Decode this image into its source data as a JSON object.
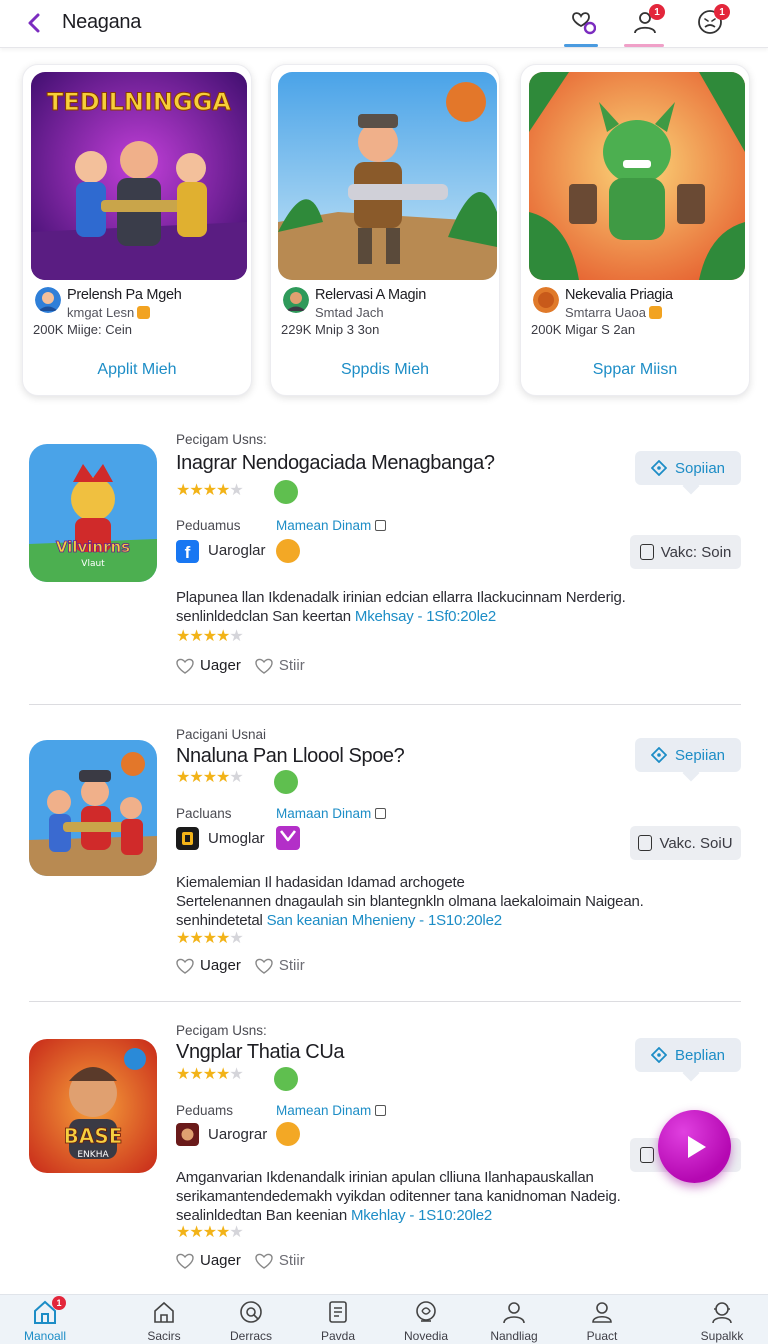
{
  "header": {
    "title": "Neagana",
    "badge_1": "1",
    "badge_2": "1",
    "colors": {
      "accent": "#7b2cbf",
      "badge": "#e3263b"
    }
  },
  "cards": [
    {
      "image_text": "TEDILNINGGA",
      "name": "Prelensh Pa Mgeh",
      "sub": "kmgat Lesn",
      "stat": "200K Miige: Cein",
      "button": "Applit Mieh"
    },
    {
      "image_text": "",
      "name": "Relervasi A Magin",
      "sub": "Smtad Jach",
      "stat": "229K Mnip 3 3on",
      "button": "Sppdis Mieh"
    },
    {
      "image_text": "",
      "name": "Nekevalia Priagia",
      "sub": "Smtarra Uaoa",
      "stat": "200K Migar S 2an",
      "button": "Sppar Miisn"
    }
  ],
  "items": [
    {
      "kicker": "Pecigam Usns:",
      "headline": "Inagrar Nendogaciada Menagbanga?",
      "thumb_text": "Vilvinrns",
      "thumb_sub": "Vlaut",
      "label_left": "Peduamus",
      "label_right": "Mamean Dinam",
      "brand_label": "Uaroglar",
      "desc_1": "Plapunea llan Ikdenadalk irinian edcian ellarra Ilackucinnam Nerderig.",
      "desc_2_pre": "senlinldedclan San keertan ",
      "desc_2_link": "Mkehsay - 1Sf0:20le2",
      "desc_3_pre": "",
      "desc_3_link": "",
      "like": "Uager",
      "share": "Stiir",
      "pill": "Sopiian",
      "pill2": "Vakc: Soin",
      "rating": 4,
      "rating2": 4
    },
    {
      "kicker": "Pacigani Usnai",
      "headline": "Nnaluna Pan Lloool Spoe?",
      "thumb_text": "",
      "thumb_sub": "",
      "label_left": "Pacluans",
      "label_right": "Mamaan Dinam",
      "brand_label": "Umoglar",
      "desc_1": "Kiemalemian Il hadasidan Idamad archogete",
      "desc_2_pre": "Sertelenannen dnagaulah sin blantegnkln olmana laekaloimain Naigean.",
      "desc_2_link": "",
      "desc_3_pre": "senhindetetal ",
      "desc_3_link": "San keanian Mhenieny - 1S10:20le2",
      "like": "Uager",
      "share": "Stiir",
      "pill": "Sepiian",
      "pill2": "Vakc. SoiU",
      "rating": 4,
      "rating2": 4
    },
    {
      "kicker": "Pecigam Usns:",
      "headline": "Vngplar Thatia CUa",
      "thumb_text": "BASE",
      "thumb_sub": "ENKHA",
      "label_left": "Peduams",
      "label_right": "Mamean Dinam",
      "brand_label": "Uarograr",
      "desc_1": "Amganvarian Ikdenandalk irinian apulan clliuna Ilanhapauskallan",
      "desc_2_pre": "serikamantendedemakh vyikdan oditenner tana kanidnoman Nadeig.",
      "desc_2_link": "",
      "desc_3_pre": "sealinldedtan Ban keenian ",
      "desc_3_link": "Mkehlay - 1S10:20le2",
      "like": "Uager",
      "share": "Stiir",
      "pill": "Beplian",
      "pill2": "",
      "rating": 4,
      "rating2": 4
    }
  ],
  "nav": [
    {
      "label": "Manoall",
      "active": true,
      "badge": "1"
    },
    {
      "label": "Sacirs"
    },
    {
      "label": "Derracs"
    },
    {
      "label": "Pavda"
    },
    {
      "label": "Novedia"
    },
    {
      "label": "Nandliag"
    },
    {
      "label": "Puact"
    },
    {
      "label": "Supalkk"
    }
  ]
}
